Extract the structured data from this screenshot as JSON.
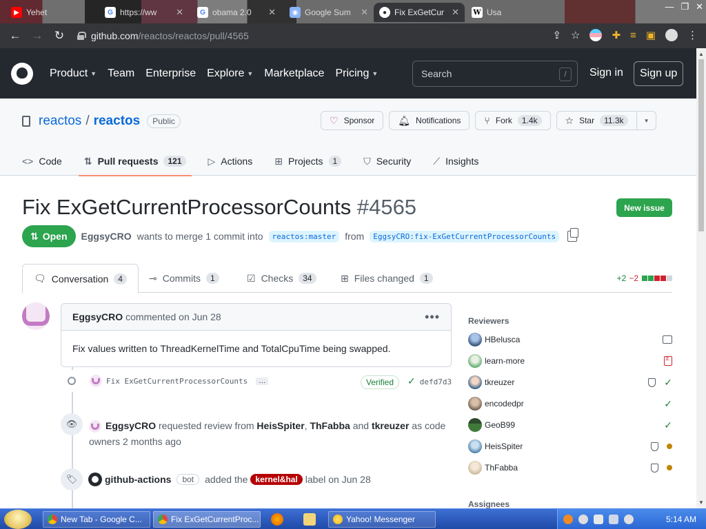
{
  "browser": {
    "tabs": [
      {
        "label": "Yehet",
        "icon": "youtube-icon",
        "color": "#ff0000"
      },
      {
        "label": "https://ww",
        "icon": "google-icon",
        "color": "#4285f4"
      },
      {
        "label": "obama 2.0",
        "icon": "google-icon",
        "color": "#4285f4"
      },
      {
        "label": "Google Sum",
        "icon": "globe-icon",
        "color": "#8ab4f8"
      },
      {
        "label": "Fix ExGetCur",
        "icon": "github-icon",
        "color": "#ffffff",
        "active": true
      },
      {
        "label": "Usa",
        "icon": "wikipedia-icon",
        "color": "#ffffff"
      }
    ],
    "url_host": "github.com",
    "url_path": "/reactos/reactos/pull/4565"
  },
  "header": {
    "nav": [
      {
        "label": "Product",
        "caret": true
      },
      {
        "label": "Team",
        "caret": false
      },
      {
        "label": "Enterprise",
        "caret": false
      },
      {
        "label": "Explore",
        "caret": true
      },
      {
        "label": "Marketplace",
        "caret": false
      },
      {
        "label": "Pricing",
        "caret": true
      }
    ],
    "search_placeholder": "Search",
    "search_key": "/",
    "signin": "Sign in",
    "signup": "Sign up"
  },
  "repo": {
    "owner": "reactos",
    "name": "reactos",
    "visibility": "Public",
    "sponsor": "Sponsor",
    "notifications": "Notifications",
    "fork_label": "Fork",
    "fork_count": "1.4k",
    "star_label": "Star",
    "star_count": "11.3k",
    "tabs": [
      {
        "label": "Code",
        "icon": "code-icon",
        "count": ""
      },
      {
        "label": "Pull requests",
        "icon": "pull-request-icon",
        "count": "121",
        "selected": true
      },
      {
        "label": "Actions",
        "icon": "play-icon",
        "count": ""
      },
      {
        "label": "Projects",
        "icon": "table-icon",
        "count": "1"
      },
      {
        "label": "Security",
        "icon": "shield-icon",
        "count": ""
      },
      {
        "label": "Insights",
        "icon": "graph-icon",
        "count": ""
      }
    ]
  },
  "pr": {
    "title": "Fix ExGetCurrentProcessorCounts",
    "number": "#4565",
    "new_issue": "New issue",
    "state": "Open",
    "author": "EggsyCRO",
    "meta_text": "wants to merge 1 commit into",
    "base_branch": "reactos:master",
    "from_text": "from",
    "head_branch": "EggsyCRO:fix-ExGetCurrentProcessorCounts",
    "tabs": [
      {
        "label": "Conversation",
        "count": "4",
        "selected": true
      },
      {
        "label": "Commits",
        "count": "1"
      },
      {
        "label": "Checks",
        "count": "34"
      },
      {
        "label": "Files changed",
        "count": "1"
      }
    ],
    "additions": "+2",
    "deletions": "−2"
  },
  "comment": {
    "author": "EggsyCRO",
    "meta": "commented on Jun 28",
    "body": "Fix values written to ThreadKernelTime and TotalCpuTime being swapped."
  },
  "timeline": {
    "commit_msg": "Fix ExGetCurrentProcessorCounts",
    "commit_ellipsis": "…",
    "verified": "Verified",
    "sha": "defd7d3",
    "review_actor": "EggsyCRO",
    "review_text1": "requested review from",
    "review_user1": "HeisSpiter",
    "review_sep": ",",
    "review_user2": "ThFabba",
    "review_and": "and",
    "review_user3": "tkreuzer",
    "review_text2": "as code",
    "review_text3": "owners 2 months ago",
    "label_actor": "github-actions",
    "bot": "bot",
    "label_added": "added the",
    "label_name": "kernel&hal",
    "label_when": "label on Jun 28"
  },
  "sidebar": {
    "reviewers_title": "Reviewers",
    "reviewers": [
      {
        "name": "HBelusca",
        "status": "commented",
        "codeowner": false
      },
      {
        "name": "learn-more",
        "status": "changes-requested",
        "codeowner": false
      },
      {
        "name": "tkreuzer",
        "status": "approved",
        "codeowner": true
      },
      {
        "name": "encodedpr",
        "status": "approved",
        "codeowner": false
      },
      {
        "name": "GeoB99",
        "status": "approved",
        "codeowner": false
      },
      {
        "name": "HeisSpiter",
        "status": "pending",
        "codeowner": true
      },
      {
        "name": "ThFabba",
        "status": "pending",
        "codeowner": true
      }
    ],
    "assignees_title": "Assignees"
  },
  "taskbar": {
    "items": [
      {
        "label": "New Tab - Google C..."
      },
      {
        "label": "Fix ExGetCurrentProc..."
      },
      {
        "label": "Yahoo! Messenger"
      }
    ],
    "clock": "5:14 AM"
  }
}
